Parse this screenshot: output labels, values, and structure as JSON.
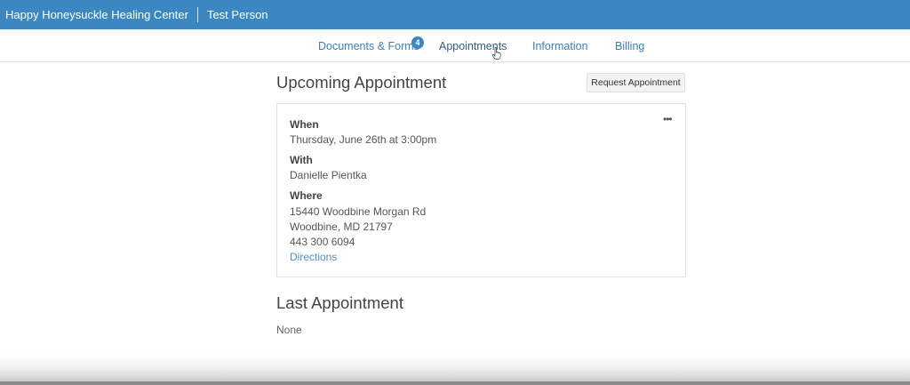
{
  "header": {
    "org_name": "Happy Honeysuckle Healing Center",
    "user_name": "Test Person",
    "bar_color": "#3a87c2"
  },
  "tabs": [
    {
      "label": "Documents & Forms",
      "badge": "4"
    },
    {
      "label": "Appointments",
      "active": true
    },
    {
      "label": "Information"
    },
    {
      "label": "Billing"
    }
  ],
  "upcoming": {
    "heading": "Upcoming Appointment",
    "request_button": "Request Appointment",
    "when_label": "When",
    "when_value": "Thursday, June 26th at 3:00pm",
    "with_label": "With",
    "with_value": "Danielle Pientka",
    "where_label": "Where",
    "address_line1": "15440 Woodbine Morgan Rd",
    "address_line2": "Woodbine, MD 21797",
    "phone": "443 300 6094",
    "directions_link": "Directions",
    "menu_icon": "ellipsis-icon"
  },
  "last": {
    "heading": "Last Appointment",
    "value": "None"
  }
}
